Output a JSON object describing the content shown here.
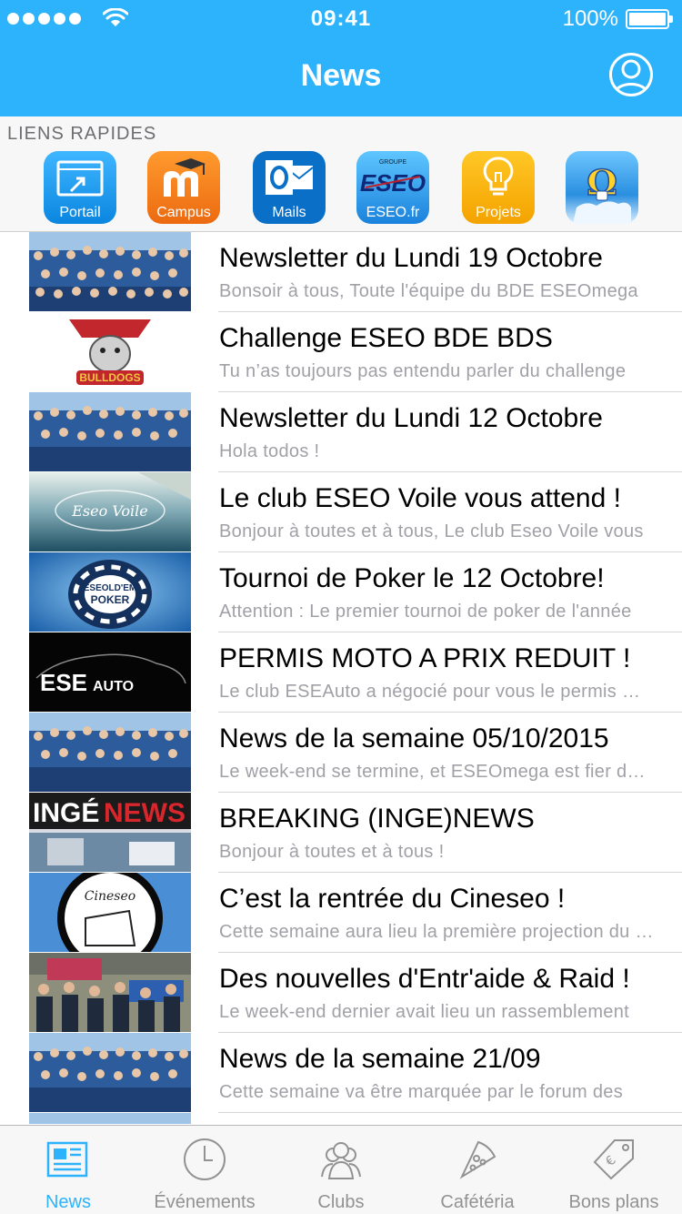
{
  "status": {
    "time": "09:41",
    "battery": "100%"
  },
  "header": {
    "title": "News"
  },
  "quick_links": {
    "title": "LIENS RAPIDES",
    "items": [
      {
        "label": "Portail",
        "icon": "portal-icon",
        "color": "#1a9cf0"
      },
      {
        "label": "Campus",
        "icon": "moodle-icon",
        "color": "#f7801f"
      },
      {
        "label": "Mails",
        "icon": "outlook-icon",
        "color": "#0a6fc7"
      },
      {
        "label": "ESEO.fr",
        "icon": "eseo-logo-icon",
        "color": "#2a8fe0"
      },
      {
        "label": "Projets",
        "icon": "lightbulb-icon",
        "color": "#f9b200"
      },
      {
        "label": "",
        "icon": "omega-icon",
        "color": "#2a8fe0"
      }
    ]
  },
  "news": [
    {
      "title": "Newsletter du Lundi 19 Octobre",
      "subtitle": "Bonsoir à tous, Toute l'équipe du BDE ESEOmega",
      "thumb": "group-photo"
    },
    {
      "title": "Challenge ESEO BDE BDS",
      "subtitle": "Tu n’as toujours pas entendu parler du challenge",
      "thumb": "bulldogs-logo"
    },
    {
      "title": "Newsletter du Lundi 12 Octobre",
      "subtitle": "Hola todos !",
      "thumb": "group-photo"
    },
    {
      "title": "Le club ESEO Voile vous attend !",
      "subtitle": "Bonjour à toutes et à tous, Le club Eseo Voile vous",
      "thumb": "sailing-photo"
    },
    {
      "title": "Tournoi de Poker le 12 Octobre!",
      "subtitle": "Attention : Le premier tournoi de poker de l'année",
      "thumb": "poker-logo"
    },
    {
      "title": "PERMIS MOTO A PRIX REDUIT !",
      "subtitle": "Le club ESEAuto a négocié pour vous le permis moto",
      "thumb": "eseauto-logo"
    },
    {
      "title": "News de la semaine 05/10/2015",
      "subtitle": "Le week-end se termine, et ESEOmega est fier de vous",
      "thumb": "group-photo"
    },
    {
      "title": "BREAKING (INGE)NEWS",
      "subtitle": "Bonjour à toutes et à tous !",
      "thumb": "ingenews-logo"
    },
    {
      "title": "C’est la rentrée du Cineseo !",
      "subtitle": "Cette semaine aura lieu la première projection du club",
      "thumb": "cineseo-logo"
    },
    {
      "title": "Des nouvelles d'Entr'aide & Raid !",
      "subtitle": "Le week-end dernier avait lieu un rassemblement",
      "thumb": "group-photo-2"
    },
    {
      "title": "News de la semaine 21/09",
      "subtitle": "Cette semaine va être marquée par le forum des",
      "thumb": "group-photo"
    }
  ],
  "tabs": [
    {
      "label": "News",
      "icon": "newspaper-icon",
      "active": true
    },
    {
      "label": "Événements",
      "icon": "clock-icon",
      "active": false
    },
    {
      "label": "Clubs",
      "icon": "people-icon",
      "active": false
    },
    {
      "label": "Cafétéria",
      "icon": "pizza-icon",
      "active": false
    },
    {
      "label": "Bons plans",
      "icon": "tag-icon",
      "active": false
    }
  ],
  "colors": {
    "accent": "#2db3fb",
    "subtitle": "#a0a0a6",
    "separator": "#d6d6da"
  }
}
